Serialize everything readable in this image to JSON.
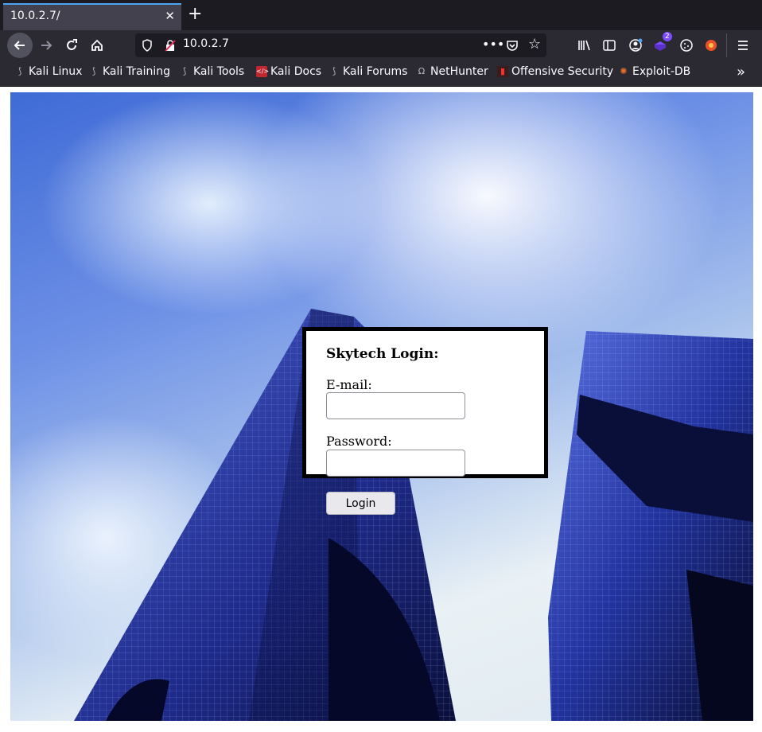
{
  "browser": {
    "tab_title": "10.0.2.7/",
    "tab_close": "✕",
    "new_tab": "+",
    "url": "10.0.2.7",
    "extension_badge": "2"
  },
  "bookmarks": [
    {
      "label": "Kali Linux",
      "icon": "kali-dragon-icon"
    },
    {
      "label": "Kali Training",
      "icon": "kali-dragon-icon"
    },
    {
      "label": "Kali Tools",
      "icon": "kali-dragon-icon"
    },
    {
      "label": "Kali Docs",
      "icon": "kali-docs-icon"
    },
    {
      "label": "Kali Forums",
      "icon": "kali-dragon-icon"
    },
    {
      "label": "NetHunter",
      "icon": "nethunter-icon"
    },
    {
      "label": "Offensive Security",
      "icon": "offsec-icon"
    },
    {
      "label": "Exploit-DB",
      "icon": "exploitdb-icon"
    }
  ],
  "page": {
    "title": "Skytech Login:",
    "email_label": "E-mail:",
    "email_value": "",
    "password_label": "Password:",
    "password_value": "",
    "login_button": "Login"
  },
  "colors": {
    "chrome_dark": "#1c1b22",
    "toolbar": "#2b2a33",
    "tab_active": "#42414d",
    "accent": "#4ea3f5"
  }
}
